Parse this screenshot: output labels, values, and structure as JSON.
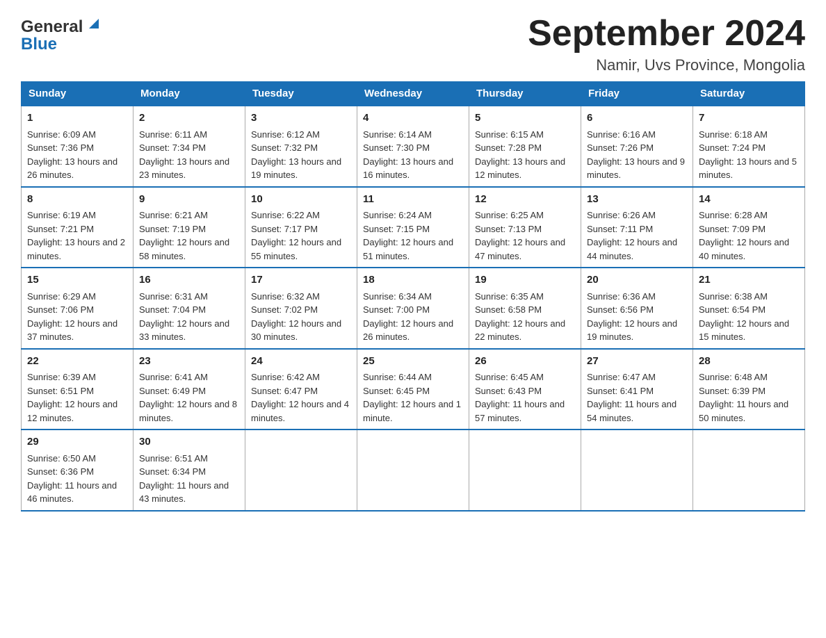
{
  "logo": {
    "line1": "General",
    "line2": "Blue"
  },
  "title": "September 2024",
  "subtitle": "Namir, Uvs Province, Mongolia",
  "days_of_week": [
    "Sunday",
    "Monday",
    "Tuesday",
    "Wednesday",
    "Thursday",
    "Friday",
    "Saturday"
  ],
  "weeks": [
    [
      {
        "day": "1",
        "sunrise": "Sunrise: 6:09 AM",
        "sunset": "Sunset: 7:36 PM",
        "daylight": "Daylight: 13 hours and 26 minutes."
      },
      {
        "day": "2",
        "sunrise": "Sunrise: 6:11 AM",
        "sunset": "Sunset: 7:34 PM",
        "daylight": "Daylight: 13 hours and 23 minutes."
      },
      {
        "day": "3",
        "sunrise": "Sunrise: 6:12 AM",
        "sunset": "Sunset: 7:32 PM",
        "daylight": "Daylight: 13 hours and 19 minutes."
      },
      {
        "day": "4",
        "sunrise": "Sunrise: 6:14 AM",
        "sunset": "Sunset: 7:30 PM",
        "daylight": "Daylight: 13 hours and 16 minutes."
      },
      {
        "day": "5",
        "sunrise": "Sunrise: 6:15 AM",
        "sunset": "Sunset: 7:28 PM",
        "daylight": "Daylight: 13 hours and 12 minutes."
      },
      {
        "day": "6",
        "sunrise": "Sunrise: 6:16 AM",
        "sunset": "Sunset: 7:26 PM",
        "daylight": "Daylight: 13 hours and 9 minutes."
      },
      {
        "day": "7",
        "sunrise": "Sunrise: 6:18 AM",
        "sunset": "Sunset: 7:24 PM",
        "daylight": "Daylight: 13 hours and 5 minutes."
      }
    ],
    [
      {
        "day": "8",
        "sunrise": "Sunrise: 6:19 AM",
        "sunset": "Sunset: 7:21 PM",
        "daylight": "Daylight: 13 hours and 2 minutes."
      },
      {
        "day": "9",
        "sunrise": "Sunrise: 6:21 AM",
        "sunset": "Sunset: 7:19 PM",
        "daylight": "Daylight: 12 hours and 58 minutes."
      },
      {
        "day": "10",
        "sunrise": "Sunrise: 6:22 AM",
        "sunset": "Sunset: 7:17 PM",
        "daylight": "Daylight: 12 hours and 55 minutes."
      },
      {
        "day": "11",
        "sunrise": "Sunrise: 6:24 AM",
        "sunset": "Sunset: 7:15 PM",
        "daylight": "Daylight: 12 hours and 51 minutes."
      },
      {
        "day": "12",
        "sunrise": "Sunrise: 6:25 AM",
        "sunset": "Sunset: 7:13 PM",
        "daylight": "Daylight: 12 hours and 47 minutes."
      },
      {
        "day": "13",
        "sunrise": "Sunrise: 6:26 AM",
        "sunset": "Sunset: 7:11 PM",
        "daylight": "Daylight: 12 hours and 44 minutes."
      },
      {
        "day": "14",
        "sunrise": "Sunrise: 6:28 AM",
        "sunset": "Sunset: 7:09 PM",
        "daylight": "Daylight: 12 hours and 40 minutes."
      }
    ],
    [
      {
        "day": "15",
        "sunrise": "Sunrise: 6:29 AM",
        "sunset": "Sunset: 7:06 PM",
        "daylight": "Daylight: 12 hours and 37 minutes."
      },
      {
        "day": "16",
        "sunrise": "Sunrise: 6:31 AM",
        "sunset": "Sunset: 7:04 PM",
        "daylight": "Daylight: 12 hours and 33 minutes."
      },
      {
        "day": "17",
        "sunrise": "Sunrise: 6:32 AM",
        "sunset": "Sunset: 7:02 PM",
        "daylight": "Daylight: 12 hours and 30 minutes."
      },
      {
        "day": "18",
        "sunrise": "Sunrise: 6:34 AM",
        "sunset": "Sunset: 7:00 PM",
        "daylight": "Daylight: 12 hours and 26 minutes."
      },
      {
        "day": "19",
        "sunrise": "Sunrise: 6:35 AM",
        "sunset": "Sunset: 6:58 PM",
        "daylight": "Daylight: 12 hours and 22 minutes."
      },
      {
        "day": "20",
        "sunrise": "Sunrise: 6:36 AM",
        "sunset": "Sunset: 6:56 PM",
        "daylight": "Daylight: 12 hours and 19 minutes."
      },
      {
        "day": "21",
        "sunrise": "Sunrise: 6:38 AM",
        "sunset": "Sunset: 6:54 PM",
        "daylight": "Daylight: 12 hours and 15 minutes."
      }
    ],
    [
      {
        "day": "22",
        "sunrise": "Sunrise: 6:39 AM",
        "sunset": "Sunset: 6:51 PM",
        "daylight": "Daylight: 12 hours and 12 minutes."
      },
      {
        "day": "23",
        "sunrise": "Sunrise: 6:41 AM",
        "sunset": "Sunset: 6:49 PM",
        "daylight": "Daylight: 12 hours and 8 minutes."
      },
      {
        "day": "24",
        "sunrise": "Sunrise: 6:42 AM",
        "sunset": "Sunset: 6:47 PM",
        "daylight": "Daylight: 12 hours and 4 minutes."
      },
      {
        "day": "25",
        "sunrise": "Sunrise: 6:44 AM",
        "sunset": "Sunset: 6:45 PM",
        "daylight": "Daylight: 12 hours and 1 minute."
      },
      {
        "day": "26",
        "sunrise": "Sunrise: 6:45 AM",
        "sunset": "Sunset: 6:43 PM",
        "daylight": "Daylight: 11 hours and 57 minutes."
      },
      {
        "day": "27",
        "sunrise": "Sunrise: 6:47 AM",
        "sunset": "Sunset: 6:41 PM",
        "daylight": "Daylight: 11 hours and 54 minutes."
      },
      {
        "day": "28",
        "sunrise": "Sunrise: 6:48 AM",
        "sunset": "Sunset: 6:39 PM",
        "daylight": "Daylight: 11 hours and 50 minutes."
      }
    ],
    [
      {
        "day": "29",
        "sunrise": "Sunrise: 6:50 AM",
        "sunset": "Sunset: 6:36 PM",
        "daylight": "Daylight: 11 hours and 46 minutes."
      },
      {
        "day": "30",
        "sunrise": "Sunrise: 6:51 AM",
        "sunset": "Sunset: 6:34 PM",
        "daylight": "Daylight: 11 hours and 43 minutes."
      },
      null,
      null,
      null,
      null,
      null
    ]
  ]
}
